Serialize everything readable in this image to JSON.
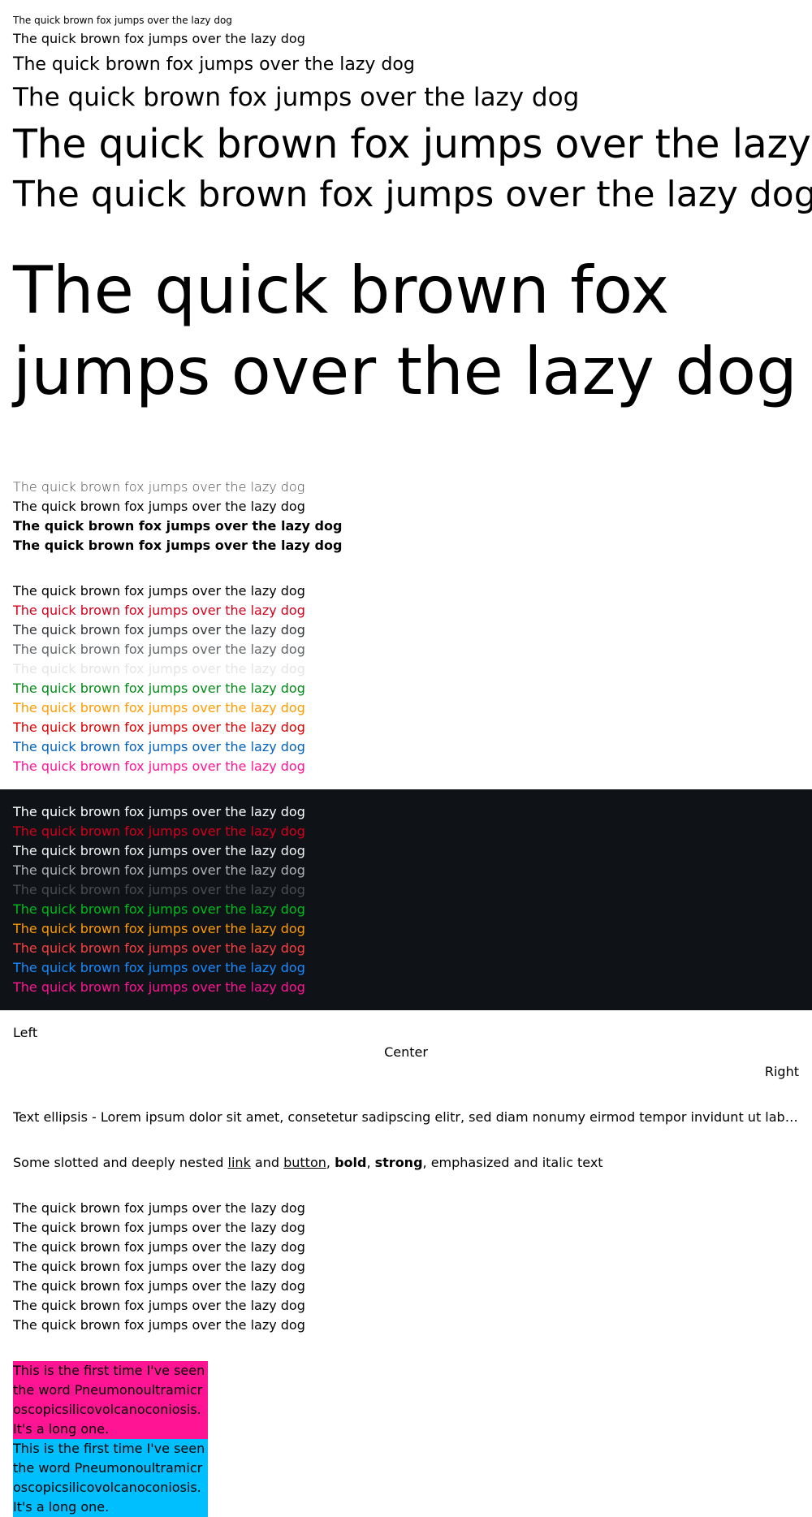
{
  "sizes": [
    "The quick brown fox jumps over the lazy dog",
    "The quick brown fox jumps over the lazy dog",
    "The quick brown fox jumps over the lazy dog",
    "The quick brown fox jumps over the lazy dog",
    "The quick brown fox jumps over the lazy dog",
    "The quick brown fox jumps over the lazy dog",
    "The quick brown fox jumps over the lazy dog"
  ],
  "weights": [
    "The quick brown fox jumps over the lazy dog",
    "The quick brown fox jumps over the lazy dog",
    "The quick brown fox jumps over the lazy dog",
    "The quick brown fox jumps over the lazy dog"
  ],
  "light_colors": [
    {
      "text": "The quick brown fox jumps over the lazy dog",
      "color": "#000000"
    },
    {
      "text": "The quick brown fox jumps over the lazy dog",
      "color": "#d5001c"
    },
    {
      "text": "The quick brown fox jumps over the lazy dog",
      "color": "#323639"
    },
    {
      "text": "The quick brown fox jumps over the lazy dog",
      "color": "#626669"
    },
    {
      "text": "The quick brown fox jumps over the lazy dog",
      "color": "#e3e4e5"
    },
    {
      "text": "The quick brown fox jumps over the lazy dog",
      "color": "#018a16"
    },
    {
      "text": "The quick brown fox jumps over the lazy dog",
      "color": "#ff9b00"
    },
    {
      "text": "The quick brown fox jumps over the lazy dog",
      "color": "#e00000"
    },
    {
      "text": "The quick brown fox jumps over the lazy dog",
      "color": "#0061bd"
    },
    {
      "text": "The quick brown fox jumps over the lazy dog",
      "color": "#ff1493"
    }
  ],
  "dark_colors": [
    {
      "text": "The quick brown fox jumps over the lazy dog",
      "color": "#ffffff"
    },
    {
      "text": "The quick brown fox jumps over the lazy dog",
      "color": "#d5001c"
    },
    {
      "text": "The quick brown fox jumps over the lazy dog",
      "color": "#f2f2f2"
    },
    {
      "text": "The quick brown fox jumps over the lazy dog",
      "color": "#b0b1b2"
    },
    {
      "text": "The quick brown fox jumps over the lazy dog",
      "color": "#4a4e51"
    },
    {
      "text": "The quick brown fox jumps over the lazy dog",
      "color": "#01ba1d"
    },
    {
      "text": "The quick brown fox jumps over the lazy dog",
      "color": "#ff9b00"
    },
    {
      "text": "The quick brown fox jumps over the lazy dog",
      "color": "#fc4040"
    },
    {
      "text": "The quick brown fox jumps over the lazy dog",
      "color": "#178bff"
    },
    {
      "text": "The quick brown fox jumps over the lazy dog",
      "color": "#ff1493"
    }
  ],
  "dark_background": "#0f1318",
  "align": {
    "left": "Left",
    "center": "Center",
    "right": "Right"
  },
  "ellipsis_text": "Text ellipsis - Lorem ipsum dolor sit amet, consetetur sadipscing elitr, sed diam nonumy eirmod tempor invidunt ut labore et dolore magna aliquyam erat, sed diam voluptua.",
  "nested": {
    "prefix": "Some slotted and deeply nested ",
    "link": "link",
    "and": " and ",
    "button": "button",
    "comma1": ", ",
    "bold": "bold",
    "comma2": ", ",
    "strong": "strong",
    "suffix": ", emphasized and italic text"
  },
  "repeat_lines": [
    "The quick brown fox jumps over the lazy dog",
    "The quick brown fox jumps over the lazy dog",
    "The quick brown fox jumps over the lazy dog",
    "The quick brown fox jumps over the lazy dog",
    "The quick brown fox jumps over the lazy dog",
    "The quick brown fox jumps over the lazy dog",
    "The quick brown fox jumps over the lazy dog"
  ],
  "long_word_boxes": [
    {
      "text": "This is the first time I've seen the word Pneumonoultramicroscopicsilicovolcanoconiosis. It's a long one.",
      "color": "#ff1493"
    },
    {
      "text": "This is the first time I've seen the word Pneumonoultramicroscopicsilicovolcanoconiosis. It's a long one.",
      "color": "#00bfff"
    }
  ]
}
